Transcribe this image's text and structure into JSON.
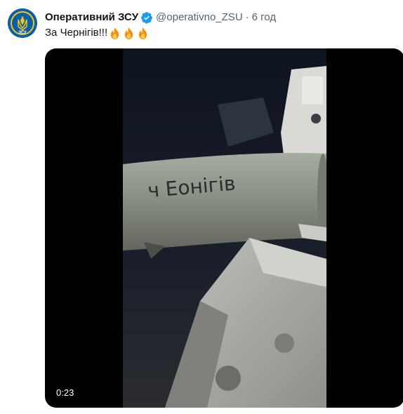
{
  "tweet": {
    "display_name": "Оперативний ЗСУ",
    "handle": "@operativno_ZSU",
    "separator": "·",
    "time": "6 год",
    "text": "За Чернігів!!!",
    "emoji_icons": [
      "fire-icon",
      "fire-icon",
      "fire-icon"
    ],
    "verified_icon": "verified-badge-icon",
    "avatar_text": "ЗСУ"
  },
  "media": {
    "type": "video",
    "duration": "0:23",
    "inscription": "ч Еонігів"
  },
  "colors": {
    "name": "#0f1419",
    "secondary": "#536471",
    "verified": "#1d9bf0",
    "avatar_bg": "#0b5ea8",
    "avatar_accent": "#f5c518",
    "fire": "#f4900c",
    "video_bg": "#000000"
  }
}
